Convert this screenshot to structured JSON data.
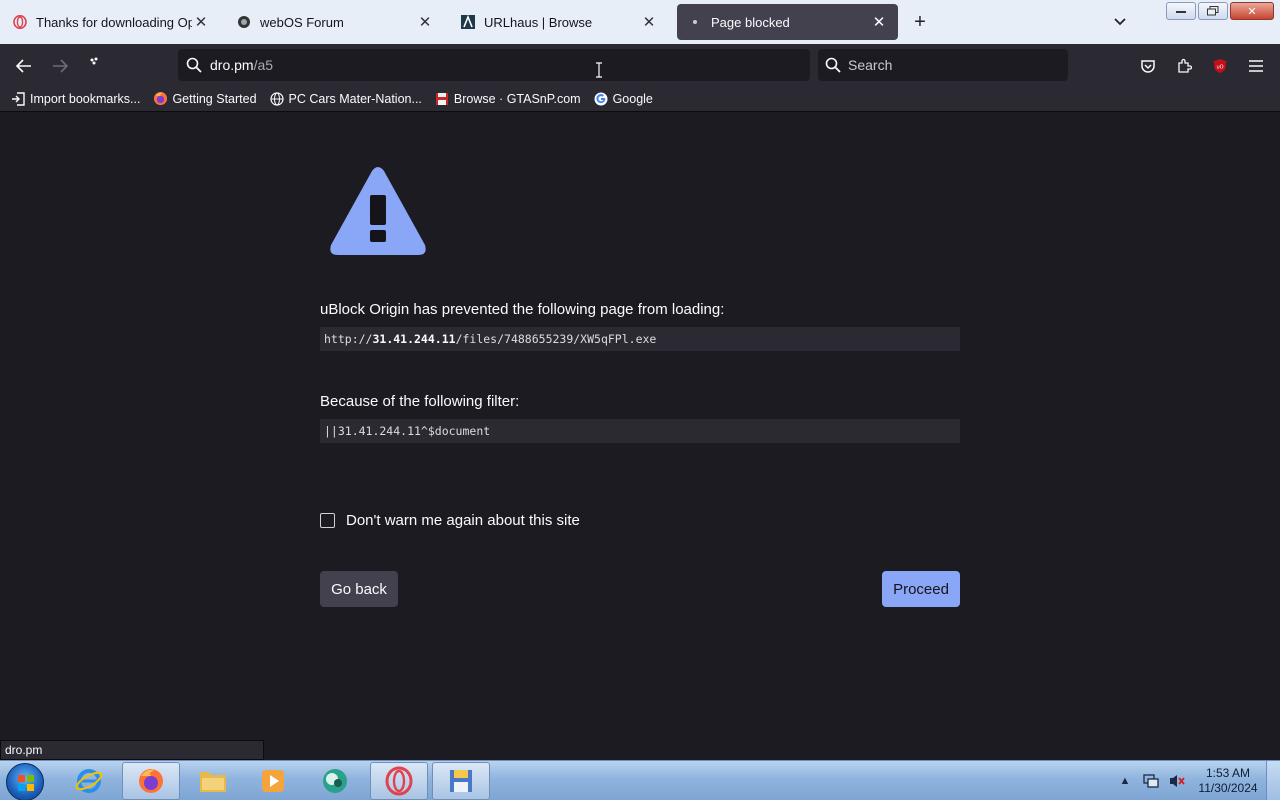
{
  "tabs": [
    {
      "label": "Thanks for downloading Opera",
      "icon": "opera-icon"
    },
    {
      "label": "webOS Forum",
      "icon": "forum-icon"
    },
    {
      "label": "URLhaus | Browse",
      "icon": "urlhaus-icon"
    },
    {
      "label": "Page blocked",
      "icon": "dot-icon",
      "active": true
    }
  ],
  "nav": {
    "url_host": "dro.pm",
    "url_path": "/a5",
    "search_placeholder": "Search"
  },
  "bookmarks": [
    {
      "label": "Import bookmarks...",
      "icon": "import-icon"
    },
    {
      "label": "Getting Started",
      "icon": "firefox-icon"
    },
    {
      "label": "PC Cars Mater-Nation...",
      "icon": "globe-icon"
    },
    {
      "label": "Browse · GTASnP.com",
      "icon": "floppy-icon"
    },
    {
      "label": "Google",
      "icon": "google-icon"
    }
  ],
  "blocked": {
    "heading": "uBlock Origin has prevented the following page from loading:",
    "url_prefix": "http://",
    "url_host": "31.41.244.11",
    "url_rest": "/files/7488655239/XW5qFPl.exe",
    "filter_heading": "Because of the following filter:",
    "filter": "||31.41.244.11^$document",
    "dont_warn": "Don't warn me again about this site",
    "go_back": "Go back",
    "proceed": "Proceed"
  },
  "status_link": "dro.pm",
  "taskbar": {
    "time": "1:53 AM",
    "date": "11/30/2024"
  },
  "colors": {
    "accent": "#8aa6f6",
    "background": "#1c1b22",
    "ublock_badge": "#c0101a"
  }
}
